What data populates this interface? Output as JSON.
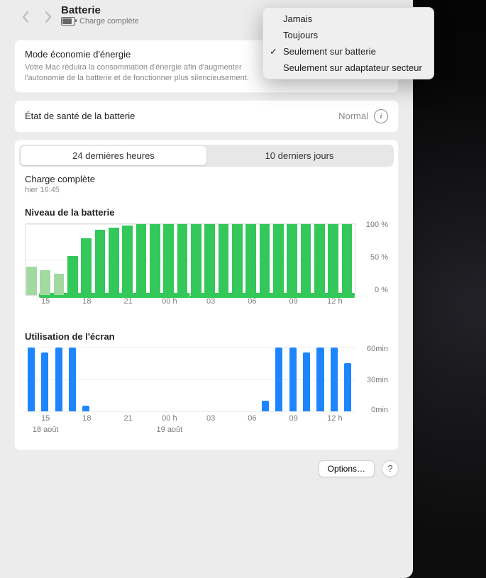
{
  "header": {
    "title": "Batterie",
    "subtitle": "Charge complète"
  },
  "low_power": {
    "label": "Mode économie d'énergie",
    "description": "Votre Mac réduira la consommation d'énergie afin d'augmenter l'autonomie de la batterie et de fonctionner plus silencieusement.",
    "menu": [
      "Jamais",
      "Toujours",
      "Seulement sur batterie",
      "Seulement sur adaptateur secteur"
    ],
    "selected_index": 2
  },
  "health": {
    "label": "État de santé de la batterie",
    "value": "Normal"
  },
  "tabs": [
    {
      "label": "24 dernières heures",
      "active": true
    },
    {
      "label": "10 derniers jours",
      "active": false
    }
  ],
  "last_charge": {
    "title": "Charge complète",
    "time": "hier 16:45"
  },
  "footer": {
    "options": "Options…"
  },
  "x_hours": [
    "15",
    "18",
    "21",
    "00 h",
    "03",
    "06",
    "09",
    "12 h"
  ],
  "x_dates": [
    {
      "label": "18 août",
      "at": "15"
    },
    {
      "label": "19 août",
      "at": "00 h"
    }
  ],
  "colors": {
    "green": "#34c759",
    "green_light": "#a1d9a1",
    "blue": "#1d86ff"
  },
  "chart_data": [
    {
      "type": "bar",
      "title": "Niveau de la batterie",
      "ylabel": "%",
      "ylim": [
        0,
        100
      ],
      "yticks": [
        "100 %",
        "50 %",
        "0 %"
      ],
      "categories_hours": [
        14,
        15,
        16,
        17,
        18,
        19,
        20,
        21,
        22,
        23,
        0,
        1,
        2,
        3,
        4,
        5,
        6,
        7,
        8,
        9,
        10,
        11,
        12,
        13
      ],
      "values": [
        40,
        35,
        30,
        55,
        80,
        92,
        95,
        98,
        100,
        100,
        100,
        100,
        100,
        100,
        100,
        100,
        100,
        100,
        100,
        100,
        100,
        100,
        100,
        100
      ],
      "charging": [
        false,
        false,
        false,
        true,
        true,
        true,
        true,
        true,
        true,
        true,
        true,
        true,
        true,
        true,
        true,
        true,
        true,
        true,
        true,
        true,
        true,
        true,
        true,
        true
      ]
    },
    {
      "type": "bar",
      "title": "Utilisation de l'écran",
      "ylabel": "min",
      "ylim": [
        0,
        60
      ],
      "yticks": [
        "60min",
        "30min",
        "0min"
      ],
      "categories_hours": [
        14,
        15,
        16,
        17,
        18,
        19,
        20,
        21,
        22,
        23,
        0,
        1,
        2,
        3,
        4,
        5,
        6,
        7,
        8,
        9,
        10,
        11,
        12,
        13
      ],
      "values": [
        60,
        55,
        60,
        60,
        5,
        0,
        0,
        0,
        0,
        0,
        0,
        0,
        0,
        0,
        0,
        0,
        0,
        10,
        60,
        60,
        55,
        60,
        60,
        45
      ]
    }
  ]
}
